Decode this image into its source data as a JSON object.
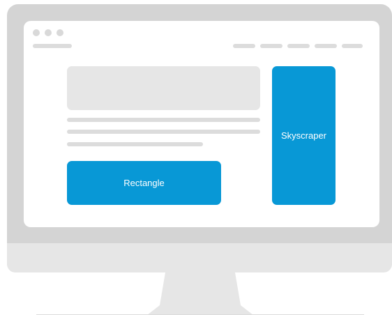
{
  "ad_slots": {
    "rectangle": {
      "label": "Rectangle"
    },
    "skyscraper": {
      "label": "Skyscraper"
    }
  },
  "colors": {
    "ad_fill": "#0898d6",
    "ad_text": "#ffffff",
    "monitor_frame": "#d4d4d4",
    "monitor_chin": "#e6e6e6",
    "placeholder": "#dcdcdc",
    "screen": "#ffffff"
  }
}
